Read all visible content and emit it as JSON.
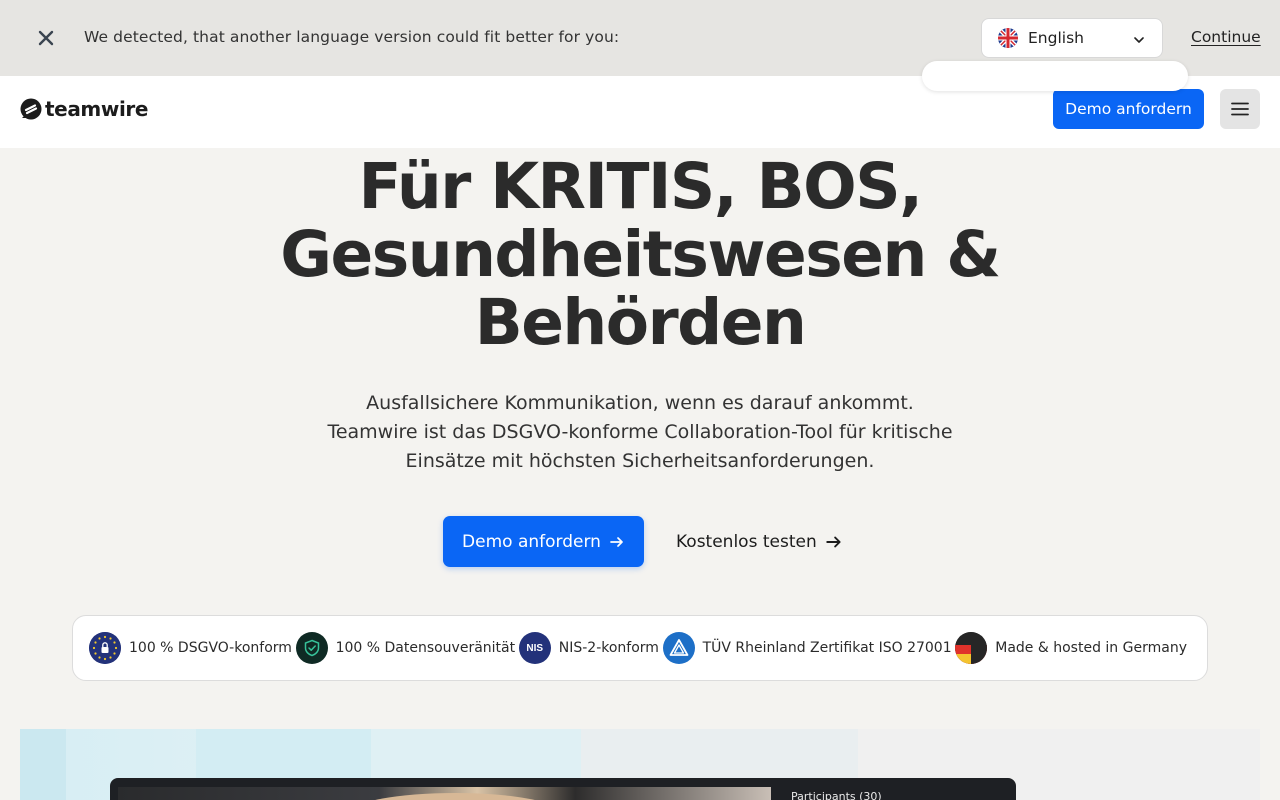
{
  "language_bar": {
    "message": "We detected, that another language version could fit better for you:",
    "selected_language": "English",
    "continue_label": "Continue"
  },
  "header": {
    "logo_text": "teamwire",
    "demo_label": "Demo anfordern"
  },
  "hero": {
    "title": "Für KRITIS, BOS, Gesundheitswesen & Behörden",
    "subtitle": "Ausfallsichere Kommunikation, wenn es darauf ankommt. Teamwire ist das DSGVO-konforme Collaboration-Tool für kritische Einsätze mit höchsten Sicherheitsanforderungen.",
    "primary_cta": "Demo anfordern",
    "secondary_cta": "Kostenlos testen"
  },
  "badges": [
    {
      "label": "100 % DSGVO-konform",
      "icon": "eu-lock-icon"
    },
    {
      "label": "100 % Datensouveränität",
      "icon": "shield-check-icon"
    },
    {
      "label": "NIS-2-konform",
      "icon": "nis-icon",
      "icon_text": "NIS"
    },
    {
      "label": "TÜV Rheinland Zertifikat ISO 27001",
      "icon": "tuv-icon"
    },
    {
      "label": "Made & hosted in Germany",
      "icon": "germany-flag-icon"
    }
  ],
  "preview": {
    "participants_label": "Participants (30)"
  },
  "colors": {
    "accent": "#0a66f5",
    "background": "#f4f3f0",
    "language_bar": "#e6e5e2"
  }
}
